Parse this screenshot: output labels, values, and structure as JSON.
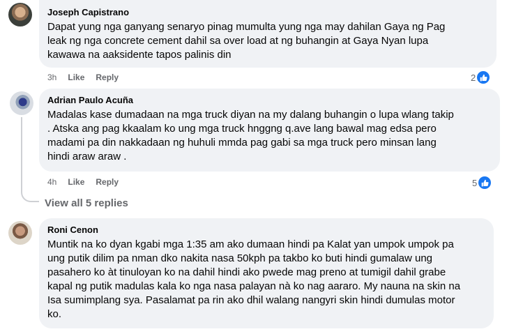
{
  "comments": [
    {
      "author": "Joseph Capistrano",
      "text": "Dapat yung nga ganyang senaryo pinag mumulta yung nga may dahilan Gaya ng Pag\nleak ng nga concrete cement dahil sa over load at ng buhangin at Gaya Nyan lupa\nkawawa na aaksidente tapos palinis din",
      "time": "3h",
      "like_label": "Like",
      "reply_label": "Reply",
      "reaction_count": "2",
      "reaction_icon": "like-icon"
    },
    {
      "author": "Adrian Paulo Acuña",
      "text": "Madalas kase dumadaan na mga truck diyan na my dalang buhangin o lupa wlang takip\n. Atska ang pag kkaalam ko ung mga truck hnggng q.ave lang bawal mag edsa pero\nmadami pa din nakkadaan ng huhuli mmda pag gabi sa mga truck pero minsan lang\nhindi araw araw .",
      "time": "4h",
      "like_label": "Like",
      "reply_label": "Reply",
      "reaction_count": "5",
      "reaction_icon": "like-icon"
    },
    {
      "author": "Roni Cenon",
      "text": "Muntik na ko dyan kgabi mga 1:35 am ako dumaan hindi pa Kalat yan umpok umpok pa\nung putik dilim pa nman dko nakita nasa 50kph pa takbo ko buti hindi gumalaw ung\npasahero ko àt tinuloyan ko na dahil hindi ako pwede mag preno at tumigil dahil grabe\nkapal ng putik madulas kala ko nga nasa palayan nà ko nag aararo. My nauna na skin na\nIsa sumimplang sya. Pasalamat pa rin ako dhil walang nangyri skin hindi dumulas motor\nko."
    }
  ],
  "view_replies_label": "View all 5 replies",
  "colors": {
    "bubble": "#f0f2f5",
    "meta_text": "#65676b",
    "like_blue": "#1877f2"
  }
}
